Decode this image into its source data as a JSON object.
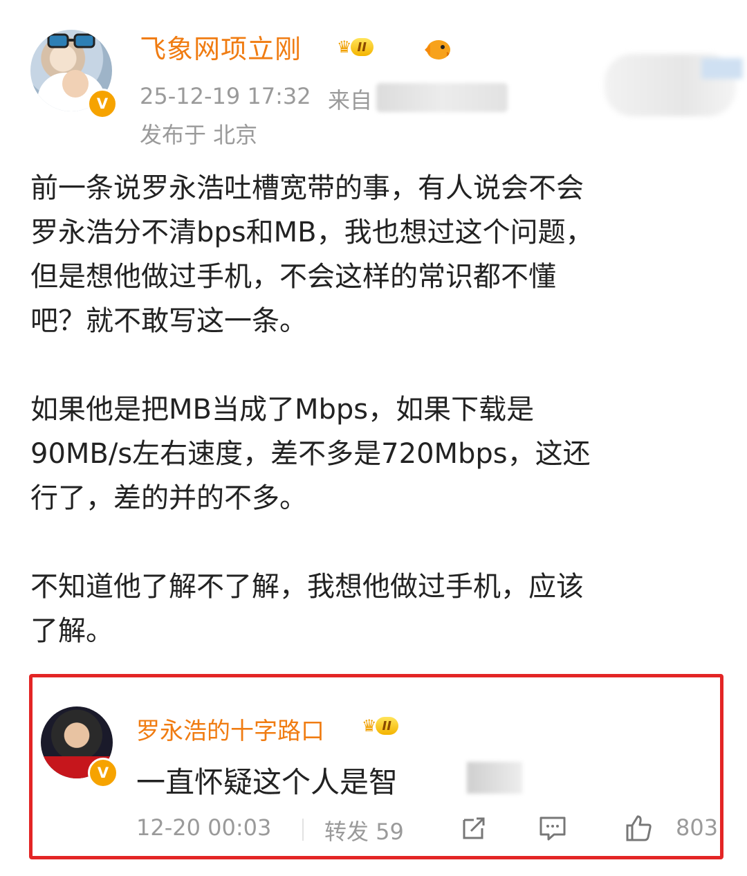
{
  "post": {
    "author": "飞象网项立刚",
    "level_badge": "II",
    "timestamp": "25-12-19 17:32",
    "from_label": "来自",
    "location": "发布于 北京",
    "paragraphs": [
      "前一条说罗永浩吐槽宽带的事，有人说会不会\n罗永浩分不清bps和MB，我也想过这个问题，\n但是想他做过手机，不会这样的常识都不懂\n吧？就不敢写这一条。",
      "如果他是把MB当成了Mbps，如果下载是\n90MB/s左右速度，差不多是720Mbps，这还\n行了，差的并的不多。",
      "不知道他了解不了解，我想他做过手机，应该\n了解。"
    ]
  },
  "repost": {
    "author": "罗永浩的十字路口",
    "level_badge": "II",
    "text": "一直怀疑这个人是智",
    "timestamp": "12-20 00:03",
    "repost_label": "转发 59",
    "likes": "803"
  },
  "badges": {
    "verified": "V"
  },
  "colors": {
    "username": "#f07c12",
    "highlight_border": "#e32525",
    "meta": "#9a9a9a",
    "verified": "#f6a300"
  }
}
